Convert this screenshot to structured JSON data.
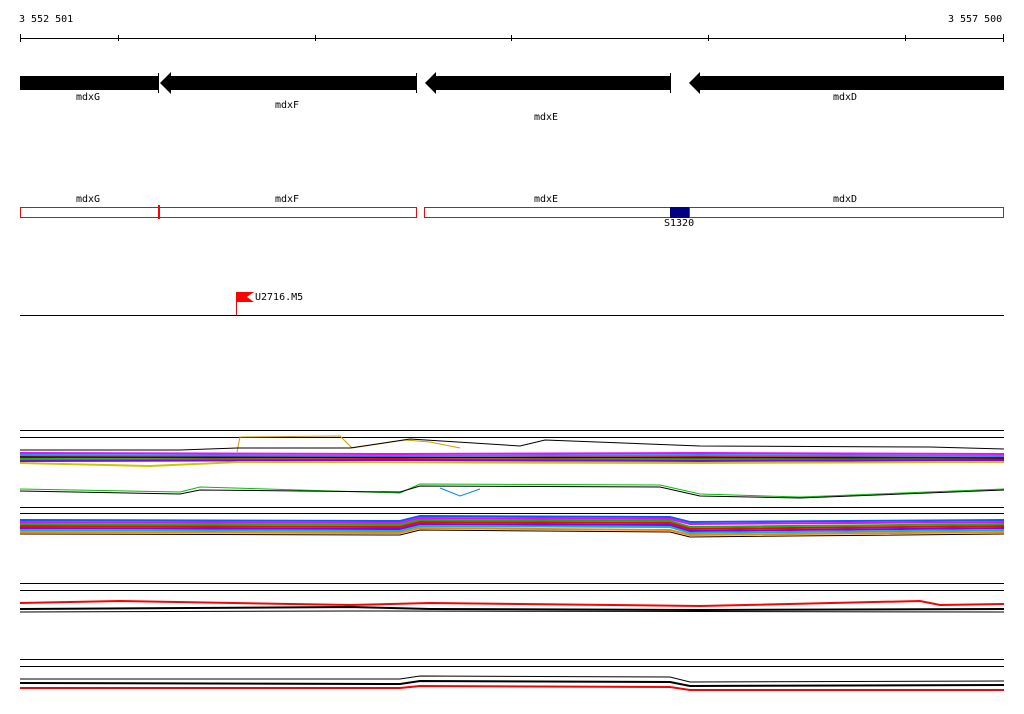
{
  "ruler": {
    "start": "3 552 501",
    "end": "3 557 500"
  },
  "genes": [
    {
      "name": "mdxG"
    },
    {
      "name": "mdxF"
    },
    {
      "name": "mdxE"
    },
    {
      "name": "mdxD"
    }
  ],
  "annotations": {
    "genes": [
      {
        "name": "mdxG"
      },
      {
        "name": "mdxF"
      },
      {
        "name": "mdxE"
      },
      {
        "name": "mdxD"
      }
    ],
    "feature": {
      "name": "S1320"
    }
  },
  "marker": {
    "name": "U2716.M5"
  },
  "colors": {
    "gene_arrow": "#000000",
    "annotation_box": "#ff0000",
    "feature_box": "#000080",
    "marker_flag": "#ff0000"
  }
}
